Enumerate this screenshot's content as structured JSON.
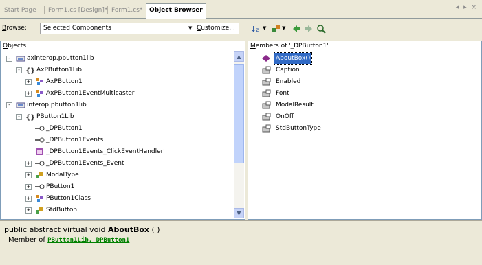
{
  "tabs": [
    {
      "label": "Start Page",
      "active": false
    },
    {
      "label": "Form1.cs [Design]*",
      "active": false
    },
    {
      "label": "Form1.cs*",
      "active": false
    },
    {
      "label": "Object Browser",
      "active": true
    }
  ],
  "tab_nav": "◂ ▸ ×",
  "browse": {
    "label_prefix": "B",
    "label_rest": "rowse:",
    "value": "Selected Components",
    "customize_prefix": "C",
    "customize_rest": "ustomize..."
  },
  "objects": {
    "header_prefix": "O",
    "header_rest": "bjects",
    "tree": [
      {
        "text": "axinterop.pbutton1lib",
        "icon": "assembly",
        "expander": "-"
      },
      {
        "text": "AxPButton1Lib",
        "icon": "namespace",
        "expander": "-"
      },
      {
        "text": "AxPButton1",
        "icon": "class",
        "expander": "+"
      },
      {
        "text": "AxPButton1EventMulticaster",
        "icon": "class",
        "expander": "+"
      },
      {
        "text": "interop.pbutton1lib",
        "icon": "assembly",
        "expander": "-"
      },
      {
        "text": "PButton1Lib",
        "icon": "namespace",
        "expander": "-"
      },
      {
        "text": "_DPButton1",
        "icon": "interface",
        "expander": ""
      },
      {
        "text": "_DPButton1Events",
        "icon": "interface",
        "expander": ""
      },
      {
        "text": "_DPButton1Events_ClickEventHandler",
        "icon": "delegate",
        "expander": ""
      },
      {
        "text": "_DPButton1Events_Event",
        "icon": "interface",
        "expander": "+"
      },
      {
        "text": "ModalType",
        "icon": "struct",
        "expander": "+"
      },
      {
        "text": "PButton1",
        "icon": "interface",
        "expander": "+"
      },
      {
        "text": "PButton1Class",
        "icon": "class",
        "expander": "+"
      },
      {
        "text": "StdButton",
        "icon": "struct",
        "expander": "+"
      }
    ]
  },
  "members": {
    "header_prefix": "M",
    "header_rest": "embers of '_DPButton1'",
    "items": [
      {
        "text": "AboutBox()",
        "icon": "method",
        "selected": true
      },
      {
        "text": "Caption",
        "icon": "property",
        "selected": false
      },
      {
        "text": "Enabled",
        "icon": "property",
        "selected": false
      },
      {
        "text": "Font",
        "icon": "property",
        "selected": false
      },
      {
        "text": "ModalResult",
        "icon": "property",
        "selected": false
      },
      {
        "text": "OnOff",
        "icon": "property",
        "selected": false
      },
      {
        "text": "StdButtonType",
        "icon": "property",
        "selected": false
      }
    ]
  },
  "description": {
    "signature_prefix": "public abstract virtual void ",
    "signature_name": "AboutBox",
    "signature_suffix": " ( )",
    "member_of_label": "Member of ",
    "member_of_link": "PButton1Lib._DPButton1"
  },
  "colors": {
    "selection": "#316ac5",
    "link": "#008000",
    "chrome": "#ece9d8"
  }
}
